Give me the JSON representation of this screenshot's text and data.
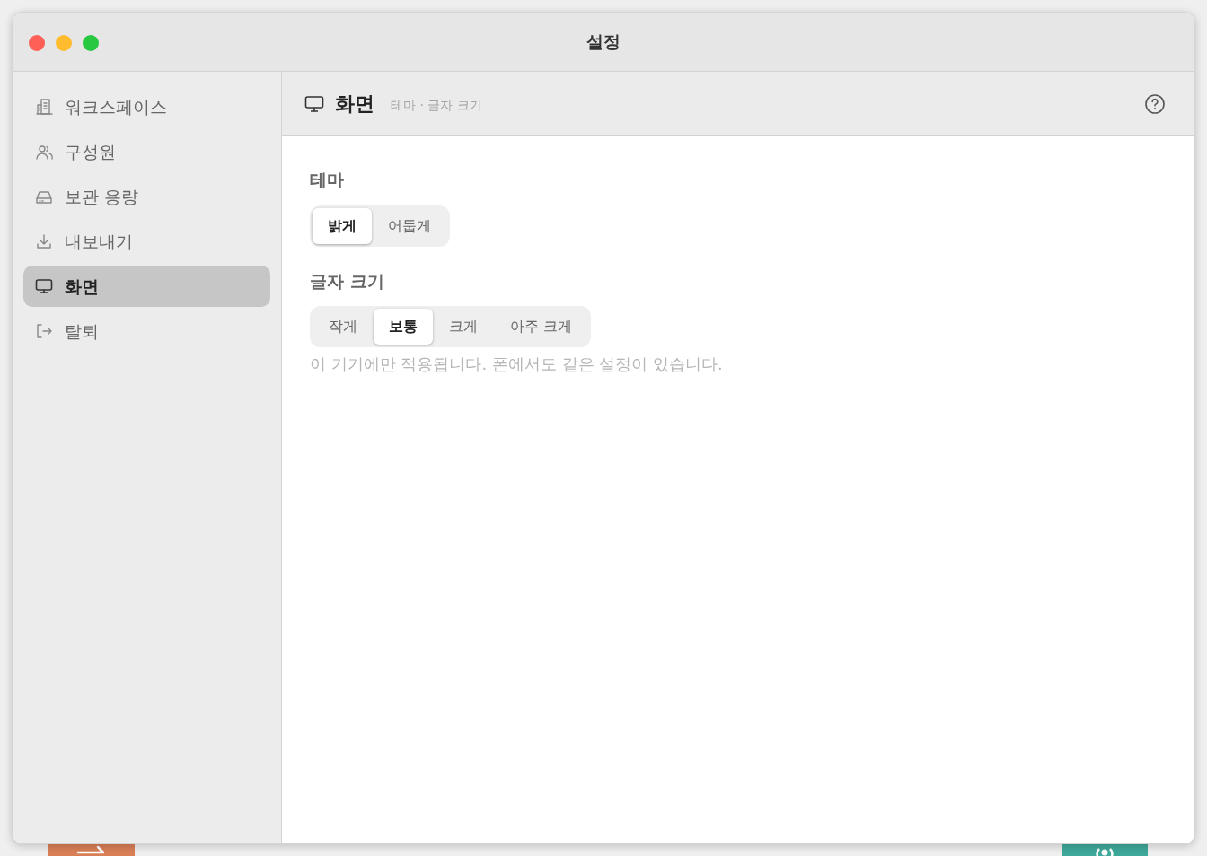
{
  "window": {
    "title": "설정"
  },
  "sidebar": {
    "items": [
      {
        "label": "워크스페이스",
        "selected": false
      },
      {
        "label": "구성원",
        "selected": false
      },
      {
        "label": "보관 용량",
        "selected": false
      },
      {
        "label": "내보내기",
        "selected": false
      },
      {
        "label": "화면",
        "selected": true
      },
      {
        "label": "탈퇴",
        "selected": false
      }
    ]
  },
  "header": {
    "title": "화면",
    "subtitle": "테마 · 글자 크기"
  },
  "sections": [
    {
      "heading": "테마",
      "options": [
        {
          "label": "밝게",
          "selected": true
        },
        {
          "label": "어둡게",
          "selected": false
        }
      ]
    },
    {
      "heading": "글자 크기",
      "options": [
        {
          "label": "작게",
          "selected": false
        },
        {
          "label": "보통",
          "selected": true
        },
        {
          "label": "크게",
          "selected": false
        },
        {
          "label": "아주 크게",
          "selected": false
        }
      ],
      "note": "이 기기에만 적용됩니다. 폰에서도 같은 설정이 있습니다."
    }
  ]
}
